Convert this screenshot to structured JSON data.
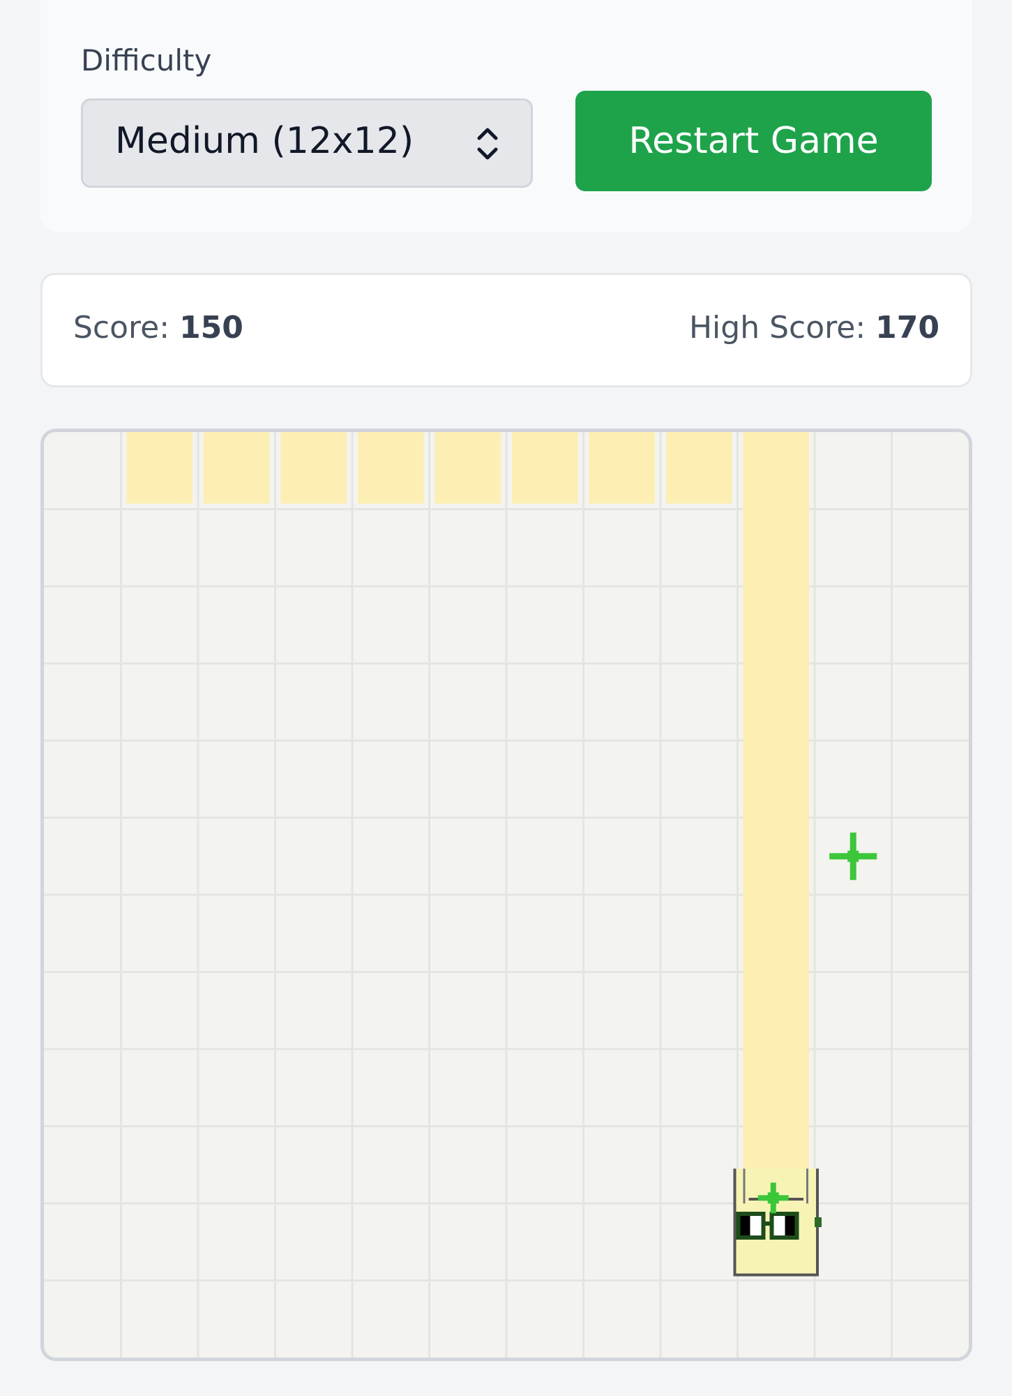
{
  "controls": {
    "difficulty_label": "Difficulty",
    "difficulty_value": "Medium (12x12)",
    "restart_label": "Restart Game"
  },
  "scores": {
    "score_label": "Score:",
    "score_value": "150",
    "high_score_label": "High Score:",
    "high_score_value": "170"
  },
  "board": {
    "grid_size": 12,
    "snake_segments": [
      [
        1,
        0
      ],
      [
        2,
        0
      ],
      [
        3,
        0
      ],
      [
        4,
        0
      ],
      [
        5,
        0
      ],
      [
        6,
        0
      ],
      [
        7,
        0
      ],
      [
        8,
        0
      ],
      [
        9,
        0
      ],
      [
        9,
        1
      ],
      [
        9,
        2
      ],
      [
        9,
        3
      ],
      [
        9,
        4
      ],
      [
        9,
        5
      ],
      [
        9,
        6
      ],
      [
        9,
        7
      ],
      [
        9,
        8
      ],
      [
        9,
        9
      ]
    ],
    "snake_head": [
      9,
      10
    ],
    "food": [
      10,
      5
    ],
    "colors": {
      "background": "#f3f3ef",
      "grid_line": "#e4e4e0",
      "snake_body": "#fdeeb3",
      "snake_head": "#f7f3b5",
      "food": "#3cc63a",
      "outline": "#555555"
    }
  },
  "accent_colors": {
    "restart_button": "#1ea34a"
  }
}
